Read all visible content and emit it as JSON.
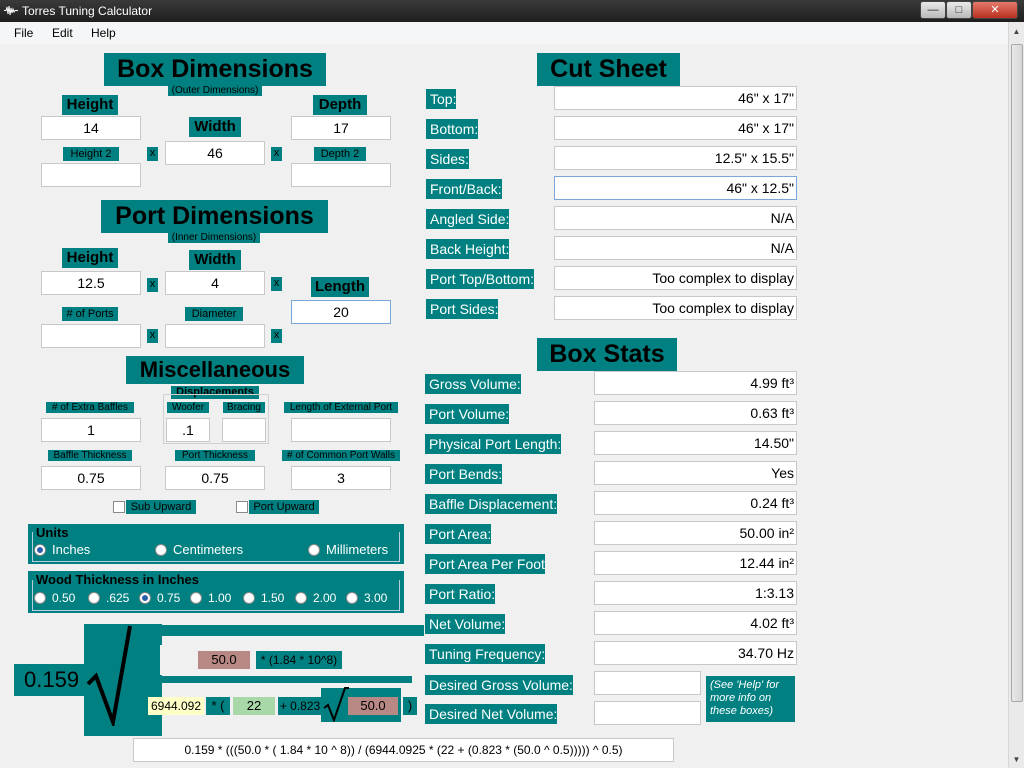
{
  "window": {
    "title": "Torres Tuning Calculator",
    "min": "—",
    "max": "□",
    "close": "✕"
  },
  "menu": [
    "File",
    "Edit",
    "Help"
  ],
  "box_dimensions": {
    "title": "Box Dimensions",
    "subtitle": "(Outer Dimensions)",
    "height_label": "Height",
    "height": "14",
    "width_label": "Width",
    "width": "46",
    "depth_label": "Depth",
    "depth": "17",
    "height2_label": "Height 2",
    "height2": "",
    "depth2_label": "Depth 2",
    "depth2": ""
  },
  "port_dimensions": {
    "title": "Port Dimensions",
    "subtitle": "(Inner Dimensions)",
    "height_label": "Height",
    "height": "12.5",
    "width_label": "Width",
    "width": "4",
    "length_label": "Length",
    "length": "20",
    "ports_label": "# of Ports",
    "ports": "",
    "diameter_label": "Diameter",
    "diameter": ""
  },
  "misc": {
    "title": "Miscellaneous",
    "displacements_label": "Displacements",
    "extra_baffles_label": "# of Extra Baffles",
    "extra_baffles": "1",
    "woofer_label": "Woofer",
    "woofer": ".1",
    "bracing_label": "Bracing",
    "bracing": "",
    "external_port_label": "Length of External Port",
    "external_port": "",
    "baffle_thickness_label": "Baffle Thickness",
    "baffle_thickness": "0.75",
    "port_thickness_label": "Port Thickness",
    "port_thickness": "0.75",
    "common_walls_label": "# of Common Port Walls",
    "common_walls": "3",
    "sub_upward": "Sub Upward",
    "port_upward": "Port Upward"
  },
  "x_sign": "x",
  "units": {
    "title": "Units",
    "options": [
      "Inches",
      "Centimeters",
      "Millimeters"
    ],
    "selected": "Inches"
  },
  "wood": {
    "title": "Wood Thickness in Inches",
    "options": [
      "0.50",
      ".625",
      "0.75",
      "1.00",
      "1.50",
      "2.00",
      "3.00"
    ],
    "selected": "0.75"
  },
  "formula": {
    "coef": "0.159",
    "area": "50.0",
    "factor": "* (1.84 * 10^8)",
    "constant": "6944.092",
    "mult_open": "* (",
    "length": "22",
    "plus": "+ 0.823",
    "area2": "50.0",
    "close_paren": ")",
    "full": "0.159 * (((50.0 * ( 1.84 * 10 ^ 8)) / (6944.0925 * (22 + (0.823 * (50.0 ^ 0.5))))) ^ 0.5)"
  },
  "cut_sheet": {
    "title": "Cut Sheet",
    "rows": [
      {
        "label": "Top:",
        "value": "46\" x 17\""
      },
      {
        "label": "Bottom:",
        "value": "46\" x 17\""
      },
      {
        "label": "Sides:",
        "value": "12.5\" x 15.5\""
      },
      {
        "label": "Front/Back:",
        "value": "46\" x 12.5\""
      },
      {
        "label": "Angled Side:",
        "value": "N/A"
      },
      {
        "label": "Back Height:",
        "value": "N/A"
      },
      {
        "label": "Port Top/Bottom:",
        "value": "Too complex to display"
      },
      {
        "label": "Port Sides:",
        "value": "Too complex to display"
      }
    ]
  },
  "box_stats": {
    "title": "Box Stats",
    "rows": [
      {
        "label": "Gross Volume:",
        "value": "4.99 ft³"
      },
      {
        "label": "Port Volume:",
        "value": "0.63 ft³"
      },
      {
        "label": "Physical Port Length:",
        "value": "14.50\""
      },
      {
        "label": "Port Bends:",
        "value": "Yes"
      },
      {
        "label": "Baffle Displacement:",
        "value": "0.24 ft³"
      },
      {
        "label": "Port Area:",
        "value": "50.00 in²"
      },
      {
        "label": "Port Area Per Foot",
        "value": "12.44 in²"
      },
      {
        "label": "Port Ratio:",
        "value": "1:3.13"
      },
      {
        "label": "Net Volume:",
        "value": "4.02 ft³"
      },
      {
        "label": "Tuning Frequency:",
        "value": "34.70 Hz"
      }
    ],
    "desired_gross_label": "Desired Gross Volume:",
    "desired_gross": "",
    "desired_net_label": "Desired Net Volume:",
    "desired_net": "",
    "help_note": "(See 'Help' for more info on these boxes)"
  },
  "colors": {
    "teal": "#008080",
    "formula_red": "#b88884",
    "formula_yellow": "#ffffc8",
    "formula_green": "#a8d8a8"
  },
  "icons": {
    "app": "waveform-icon",
    "scroll_up": "▲",
    "scroll_down": "▼"
  }
}
